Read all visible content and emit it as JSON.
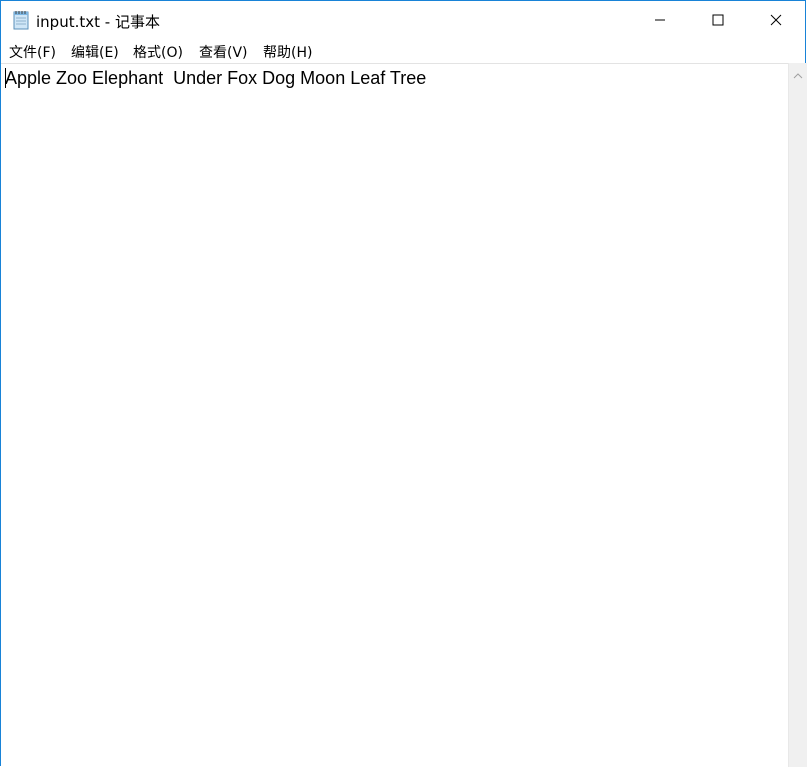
{
  "window": {
    "title": "input.txt - 记事本",
    "app_icon": "notepad-icon",
    "controls": {
      "minimize_icon": "minimize-icon",
      "maximize_icon": "maximize-icon",
      "close_icon": "close-icon"
    }
  },
  "menu": {
    "items": [
      {
        "label": "文件(F)"
      },
      {
        "label": "编辑(E)"
      },
      {
        "label": "格式(O)"
      },
      {
        "label": "查看(V)"
      },
      {
        "label": "帮助(H)"
      }
    ]
  },
  "editor": {
    "content": "Apple Zoo Elephant  Under Fox Dog Moon Leaf Tree"
  },
  "scrollbar": {
    "up_icon": "scroll-up-arrow-icon"
  },
  "colors": {
    "border": "#1883d7",
    "scrollbar_bg": "#f0f0f0"
  }
}
